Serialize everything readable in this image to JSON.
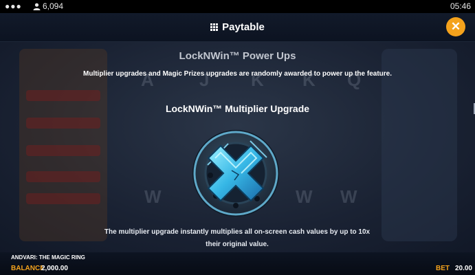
{
  "status_bar": {
    "menu_icon": "dots-icon",
    "user_icon": "user-icon",
    "balance_count": "6,094",
    "time": "05:46"
  },
  "header": {
    "title": "Paytable",
    "title_icon": "grid-icon",
    "close_label": "✕",
    "accent_color": "#f4a21c"
  },
  "content": {
    "section_title": "LockNWin™ Power Ups",
    "section_text": "Multiplier upgrades and Magic Prizes upgrades are randomly awarded to power up the feature.",
    "feature_title": "LockNWin™ Multiplier Upgrade",
    "feature_icon": "multiplier-x-emblem",
    "feature_text": "The multiplier upgrade instantly multiplies all on-screen cash values by up to 10x their original value."
  },
  "footer": {
    "game_name": "ANDVARI: THE MAGIC RING",
    "balance_label": "BALANCE",
    "balance_value": "2,000.00",
    "bet_label": "BET",
    "bet_value": "20.00"
  }
}
